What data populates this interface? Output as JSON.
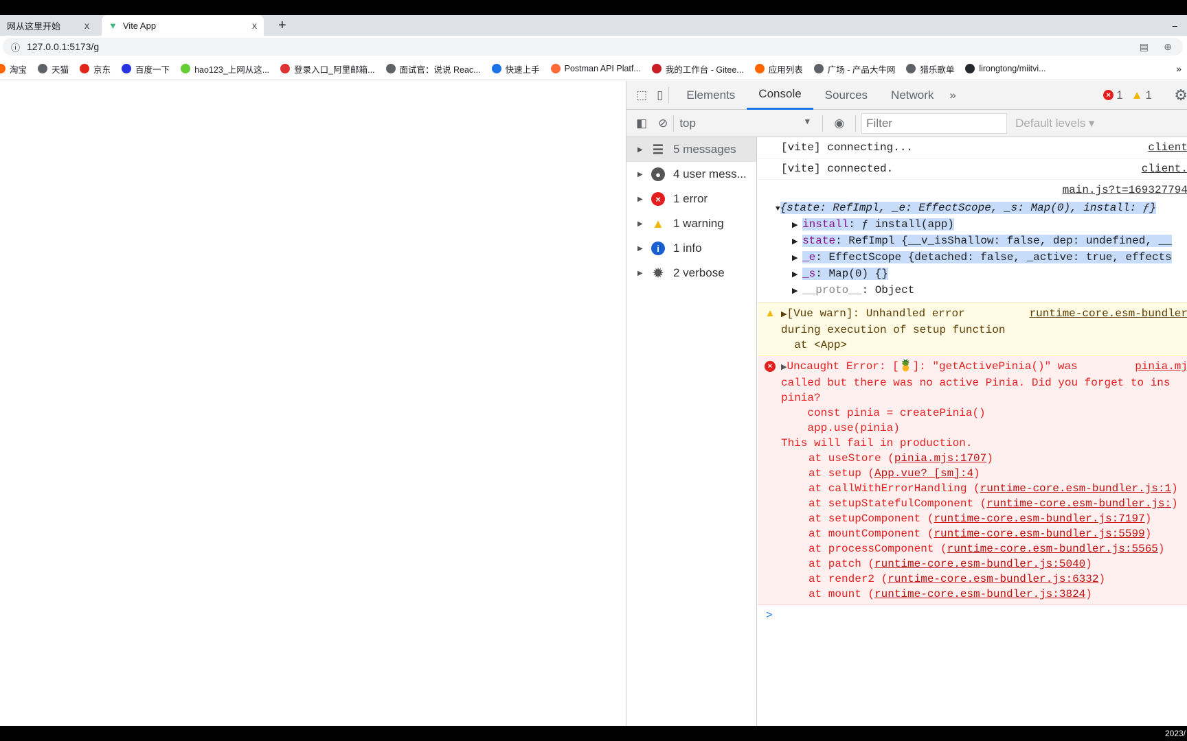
{
  "browser": {
    "tabs": [
      {
        "title": "网从这里开始"
      },
      {
        "title": "Vite App",
        "active": true
      }
    ],
    "new_tab": "+",
    "close": "x",
    "url": "127.0.0.1:5173/g",
    "bookmarks": [
      "淘宝",
      "天猫",
      "京东",
      "百度一下",
      "hao123_上网从这...",
      "登录入口_阿里邮箱...",
      "面试官：说说 Reac...",
      "快速上手",
      "Postman API Platf...",
      "我的工作台 - Gitee...",
      "应用列表",
      "广场 - 产品大牛网",
      "猎乐歌单",
      "lirongtong/miitvi..."
    ],
    "more_bookmarks": "»"
  },
  "devtools": {
    "tabs": [
      "Elements",
      "Console",
      "Sources",
      "Network"
    ],
    "active_tab": "Console",
    "more": "»",
    "error_count": "1",
    "warning_count": "1",
    "context": "top",
    "filter_placeholder": "Filter",
    "levels": "Default levels ▾",
    "sidebar": [
      {
        "label": "5 messages",
        "icon": "list-icon"
      },
      {
        "label": "4 user mess...",
        "icon": "user-icon"
      },
      {
        "label": "1 error",
        "icon": "error-icon"
      },
      {
        "label": "1 warning",
        "icon": "warning-icon"
      },
      {
        "label": "1 info",
        "icon": "info-icon"
      },
      {
        "label": "2 verbose",
        "icon": "bug-icon"
      }
    ],
    "console": {
      "log1": {
        "text": "[vite] connecting...",
        "src": "client"
      },
      "log2": {
        "text": "[vite] connected.",
        "src": "client."
      },
      "obj": {
        "src": "main.js?t=169327794",
        "summary": "{state: RefImpl, _e: EffectScope, _s: Map(0), install: ƒ}",
        "props": [
          {
            "key": "install",
            "val": ": ƒ install(app)"
          },
          {
            "key": "state",
            "val": ": RefImpl {__v_isShallow: false, dep: undefined, __"
          },
          {
            "key": "_e",
            "val": ": EffectScope {detached: false, _active: true, effects"
          },
          {
            "key": "_s",
            "val": ": Map(0) {}"
          },
          {
            "key": "__proto__",
            "val": ": Object"
          }
        ]
      },
      "warn": {
        "lines": [
          "[Vue warn]: Unhandled error",
          "during execution of setup function",
          "  at <App>"
        ],
        "src": "runtime-core.esm-bundler"
      },
      "error": {
        "src": "pinia.mj",
        "lines": [
          "Uncaught Error: [🍍]: \"getActivePinia()\" was",
          "called but there was no active Pinia. Did you forget to ins",
          "pinia?",
          "    const pinia = createPinia()",
          "    app.use(pinia)",
          "This will fail in production."
        ],
        "stack": [
          {
            "fn": "at useStore (",
            "link": "pinia.mjs:1707"
          },
          {
            "fn": "at setup (",
            "link": "App.vue?_[sm]:4"
          },
          {
            "fn": "at callWithErrorHandling (",
            "link": "runtime-core.esm-bundler.js:1"
          },
          {
            "fn": "at setupStatefulComponent (",
            "link": "runtime-core.esm-bundler.js:"
          },
          {
            "fn": "at setupComponent (",
            "link": "runtime-core.esm-bundler.js:7197"
          },
          {
            "fn": "at mountComponent (",
            "link": "runtime-core.esm-bundler.js:5599"
          },
          {
            "fn": "at processComponent (",
            "link": "runtime-core.esm-bundler.js:5565"
          },
          {
            "fn": "at patch (",
            "link": "runtime-core.esm-bundler.js:5040"
          },
          {
            "fn": "at render2 (",
            "link": "runtime-core.esm-bundler.js:6332"
          },
          {
            "fn": "at mount (",
            "link": "runtime-core.esm-bundler.js:3824"
          }
        ]
      },
      "prompt": ">"
    }
  },
  "taskbar": {
    "clock": "2023/"
  }
}
